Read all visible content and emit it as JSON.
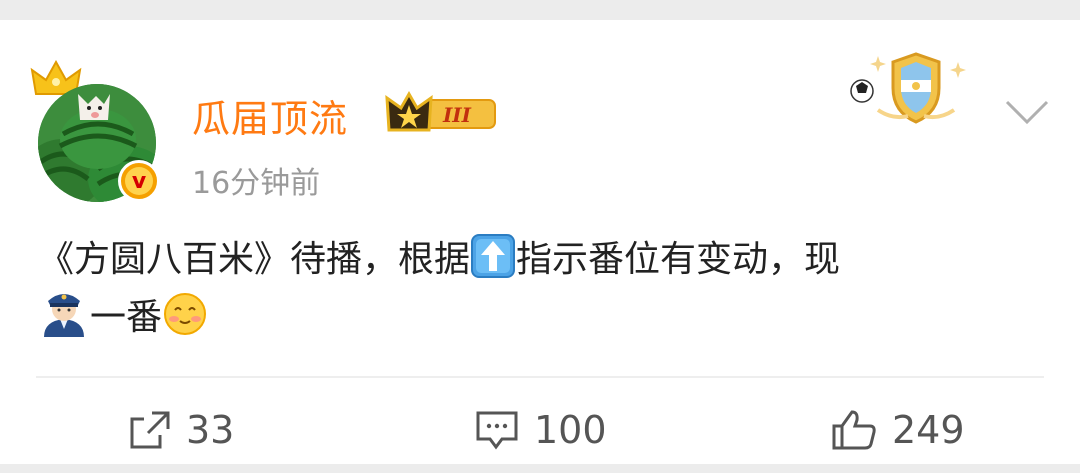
{
  "post": {
    "username": "瓜届顶流",
    "level_badge": "III",
    "time": "16分钟前",
    "content_part1": "《方圆八百米》待播，根据",
    "content_part2": "指示番位有变动，现",
    "content_part3": "一番",
    "icons": {
      "verified": "v-badge-icon",
      "crown": "crown-icon",
      "medal": "argentina-medal-icon",
      "up_arrow": "up-arrow-emoji",
      "police": "police-officer-emoji",
      "smile": "smiling-face-emoji"
    }
  },
  "actions": {
    "repost_count": "33",
    "comment_count": "100",
    "like_count": "249"
  },
  "colors": {
    "username": "#ff7a12",
    "background": "#ececec",
    "card": "#ffffff",
    "text": "#222222",
    "muted": "#9a9a9a"
  }
}
